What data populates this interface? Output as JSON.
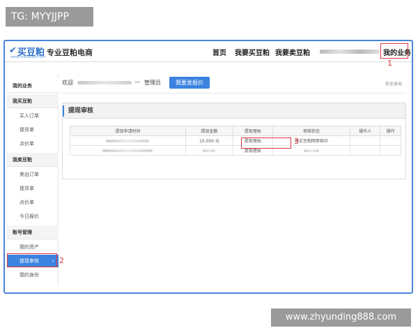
{
  "overlay": {
    "tag": "TG: MYYJJPP",
    "watermark": "www.zhyunding888.com"
  },
  "header": {
    "logo_text": "买豆粕",
    "logo_sub": "www.maidoupo.com",
    "site_title": "专业豆粕电商",
    "nav": [
      "首页",
      "我要买豆粕",
      "我要卖豆粕"
    ],
    "my_business": "我的业务"
  },
  "annotations": [
    "1",
    "2",
    "3"
  ],
  "sidebar": {
    "title": "我的业务",
    "groups": [
      {
        "label": "我买豆粕",
        "items": [
          "买入订单",
          "提货单",
          "点价单"
        ]
      },
      {
        "label": "我卖豆粕",
        "items": [
          "卖出订单",
          "提货单",
          "点价单",
          "今日报价"
        ]
      },
      {
        "label": "账号管理",
        "items": [
          "我的资产",
          "提现审核",
          "我的身份"
        ]
      }
    ]
  },
  "welcome": {
    "prefix": "欢迎",
    "dash": "—",
    "role": "管理员",
    "quote_button": "我要发报价",
    "logout": "安全退出"
  },
  "panel": {
    "title": "提现审核",
    "columns": [
      "提现申请时间",
      "提现金额",
      "提现理由",
      "审核状态",
      "操作人",
      "操作"
    ],
    "rows": [
      {
        "amount": "10,000 元",
        "reason": "提现理由",
        "status": "待买豆粕网审核中"
      },
      {
        "amount": "",
        "reason": "提现理由",
        "status": ""
      }
    ]
  },
  "colors": {
    "accent": "#3c83e0",
    "annotation": "#d9363e",
    "frame": "#4a86d8"
  }
}
